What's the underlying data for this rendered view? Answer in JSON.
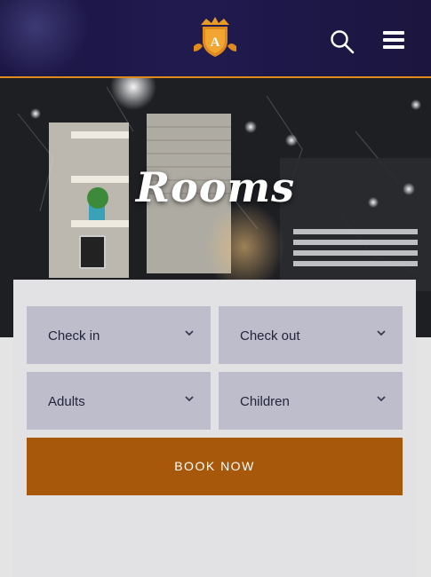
{
  "header": {
    "logo_letter": "A",
    "icons": {
      "search": "search-icon",
      "menu": "hamburger-menu-icon",
      "logo": "crown-shield-logo"
    },
    "accent_color": "#e08a1e",
    "background_color": "#1d1747"
  },
  "hero": {
    "title": "Rooms"
  },
  "booking": {
    "fields": {
      "check_in": "Check in",
      "check_out": "Check out",
      "adults": "Adults",
      "children": "Children"
    },
    "button_label": "BOOK NOW",
    "button_color": "#a8580a",
    "field_color": "#bdbdcc"
  }
}
